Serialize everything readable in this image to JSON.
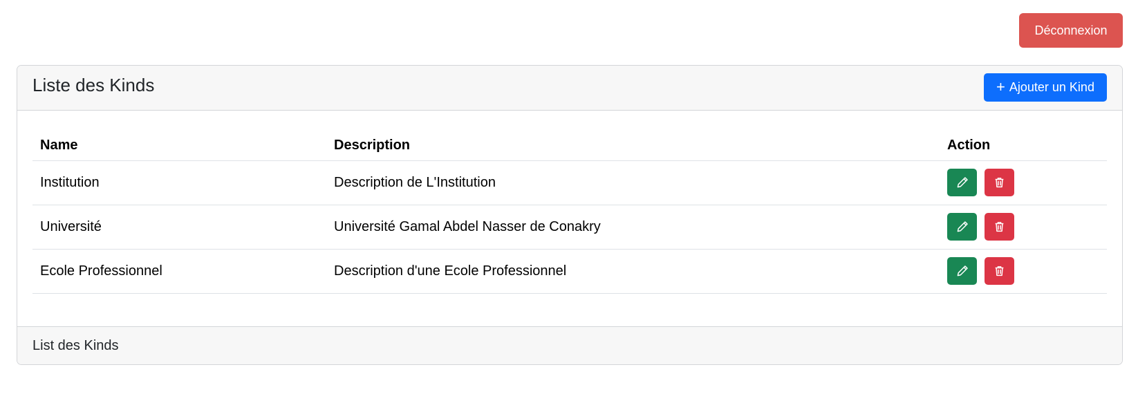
{
  "header": {
    "logout_label": "Déconnexion"
  },
  "card": {
    "title": "Liste des Kinds",
    "add_button_label": "Ajouter un Kind",
    "add_button_icon": "plus-icon",
    "footer_text": "List des Kinds"
  },
  "table": {
    "columns": [
      "Name",
      "Description",
      "Action"
    ],
    "rows": [
      {
        "name": "Institution",
        "description": "Description de L'Institution"
      },
      {
        "name": "Université",
        "description": "Université Gamal Abdel Nasser de Conakry"
      },
      {
        "name": "Ecole Professionnel",
        "description": "Description d'une Ecole Professionnel"
      }
    ],
    "row_actions": [
      {
        "icon": "pencil-icon",
        "color": "#198754"
      },
      {
        "icon": "trash-icon",
        "color": "#dc3545"
      }
    ]
  },
  "colors": {
    "logout": "#dc5450",
    "primary": "#0d6efd",
    "success": "#198754",
    "danger": "#dc3545",
    "card_header_bg": "#f7f7f7"
  }
}
